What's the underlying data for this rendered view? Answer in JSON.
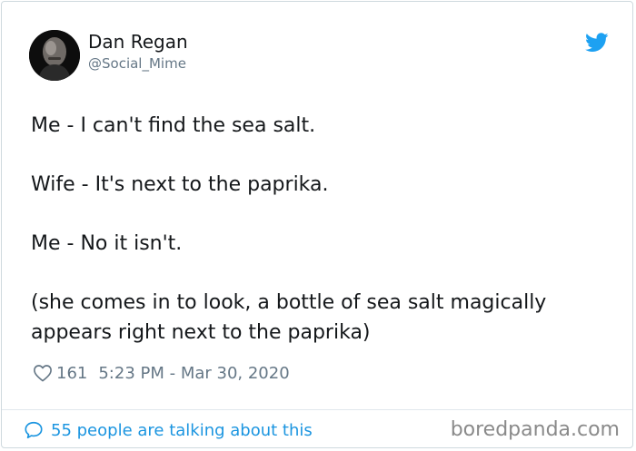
{
  "author": {
    "name": "Dan Regan",
    "handle": "@Social_Mime",
    "avatar_icon": "profile-photo",
    "platform_icon": "twitter-bird-icon",
    "platform_color": "#1da1f2"
  },
  "tweet": {
    "lines": [
      "Me - I can't find the sea salt.",
      "Wife - It's next to the paprika.",
      "Me - No it isn't.",
      "(she comes in to look, a bottle of sea salt magically appears right next to the paprika)"
    ],
    "likes": "161",
    "timestamp": "5:23 PM - Mar 30, 2020"
  },
  "footer": {
    "conversation_text": "55 people are talking about this",
    "link_color": "#1b95e0",
    "watermark": "boredpanda.com"
  }
}
